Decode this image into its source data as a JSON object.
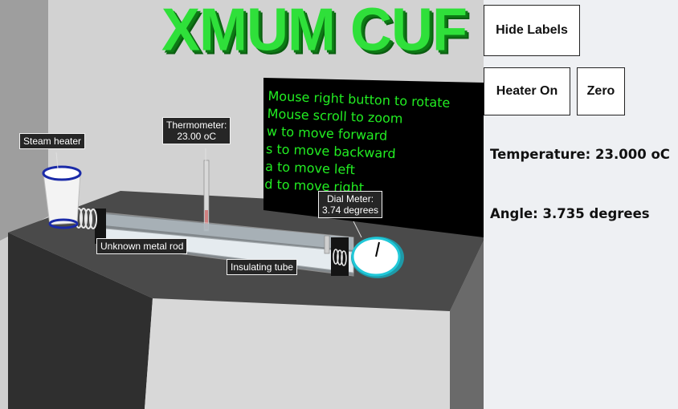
{
  "scene": {
    "banner_text": "XMUM CUF",
    "instructions": [
      "Mouse right button to rotate",
      "Mouse scroll to zoom",
      "w to move forward",
      "s to move backward",
      "a to move left",
      "d to move right"
    ],
    "labels": {
      "steam_heater": "Steam heater",
      "thermometer_line1": "Thermometer:",
      "thermometer_line2": "23.00 oC",
      "dial_meter_line1": "Dial Meter:",
      "dial_meter_line2": "3.74 degrees",
      "metal_rod": "Unknown metal rod",
      "insulating_tube": "Insulating tube"
    },
    "colors": {
      "banner": "#2fe03a",
      "instructions_text": "#22ee22",
      "board": "#000000",
      "table": "#4a4a4a",
      "dial_ring": "#20c8d8",
      "heater_ring": "#1a2aa8"
    }
  },
  "panel": {
    "hide_labels_button": "Hide Labels",
    "heater_button": "Heater On",
    "zero_button": "Zero",
    "temperature_text": "Temperature: 23.000 oC",
    "angle_text": "Angle: 3.735 degrees"
  }
}
